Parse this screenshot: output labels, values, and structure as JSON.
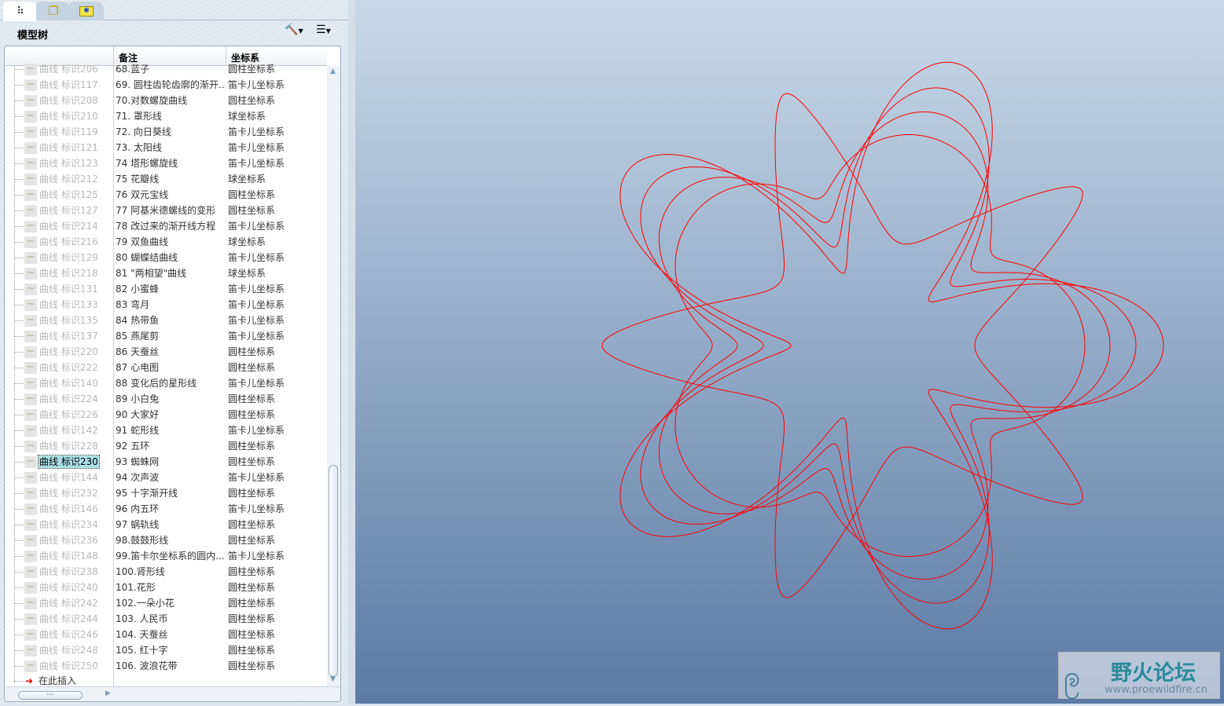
{
  "tabs": [
    {
      "icon": "model-tree-icon"
    },
    {
      "icon": "layers-icon"
    },
    {
      "icon": "folder-icon"
    }
  ],
  "panel_title": "模型树",
  "columns": [
    "备注",
    "坐标系"
  ],
  "rows": [
    {
      "name": "曲线 标识206",
      "note": "68.蓝子",
      "cs": "圆柱坐标系"
    },
    {
      "name": "曲线 标识117",
      "note": "69. 圆柱齿轮齿廓的渐开...",
      "cs": "笛卡儿坐标系"
    },
    {
      "name": "曲线 标识208",
      "note": "70.对数螺旋曲线",
      "cs": "圆柱坐标系"
    },
    {
      "name": "曲线 标识210",
      "note": "71. 罩形线",
      "cs": "球坐标系"
    },
    {
      "name": "曲线 标识119",
      "note": "72. 向日葵线",
      "cs": "笛卡儿坐标系"
    },
    {
      "name": "曲线 标识121",
      "note": "73. 太阳线",
      "cs": "笛卡儿坐标系"
    },
    {
      "name": "曲线 标识123",
      "note": "74 塔形螺旋线",
      "cs": "笛卡儿坐标系"
    },
    {
      "name": "曲线 标识212",
      "note": "75 花瓣线",
      "cs": "球坐标系"
    },
    {
      "name": "曲线 标识125",
      "note": "76 双元宝线",
      "cs": "圆柱坐标系"
    },
    {
      "name": "曲线 标识127",
      "note": "77 阿基米德螺线的变形",
      "cs": "圆柱坐标系"
    },
    {
      "name": "曲线 标识214",
      "note": "78 改过来的渐开线方程",
      "cs": "笛卡儿坐标系"
    },
    {
      "name": "曲线 标识216",
      "note": "79 双鱼曲线",
      "cs": "球坐标系"
    },
    {
      "name": "曲线 标识129",
      "note": "80 蝴蝶结曲线",
      "cs": "笛卡儿坐标系"
    },
    {
      "name": "曲线 标识218",
      "note": "81 \"两相望\"曲线",
      "cs": "球坐标系"
    },
    {
      "name": "曲线 标识131",
      "note": "82 小蜜蜂",
      "cs": "笛卡儿坐标系"
    },
    {
      "name": "曲线 标识133",
      "note": "83 弯月",
      "cs": "笛卡儿坐标系"
    },
    {
      "name": "曲线 标识135",
      "note": "84 热带鱼",
      "cs": "笛卡儿坐标系"
    },
    {
      "name": "曲线 标识137",
      "note": "85 燕尾剪",
      "cs": "笛卡儿坐标系"
    },
    {
      "name": "曲线 标识220",
      "note": "86 天蚕丝",
      "cs": "圆柱坐标系"
    },
    {
      "name": "曲线 标识222",
      "note": "87 心电图",
      "cs": "圆柱坐标系"
    },
    {
      "name": "曲线 标识140",
      "note": "88 变化后的星形线",
      "cs": "笛卡儿坐标系"
    },
    {
      "name": "曲线 标识224",
      "note": "89 小白兔",
      "cs": "圆柱坐标系"
    },
    {
      "name": "曲线 标识226",
      "note": "90 大家好",
      "cs": "圆柱坐标系"
    },
    {
      "name": "曲线 标识142",
      "note": "91 蛇形线",
      "cs": "笛卡儿坐标系"
    },
    {
      "name": "曲线 标识228",
      "note": "92 五环",
      "cs": "圆柱坐标系"
    },
    {
      "name": "曲线 标识230",
      "note": "93 蜘蛛网",
      "cs": "圆柱坐标系",
      "selected": true
    },
    {
      "name": "曲线 标识144",
      "note": "94 次声波",
      "cs": "笛卡儿坐标系"
    },
    {
      "name": "曲线 标识232",
      "note": "95 十字渐开线",
      "cs": "圆柱坐标系"
    },
    {
      "name": "曲线 标识146",
      "note": "96 内五环",
      "cs": "笛卡儿坐标系"
    },
    {
      "name": "曲线 标识234",
      "note": "97 蜗轨线",
      "cs": "圆柱坐标系"
    },
    {
      "name": "曲线 标识236",
      "note": "98.鼓鼓形线",
      "cs": "圆柱坐标系"
    },
    {
      "name": "曲线 标识148",
      "note": "99.笛卡尔坐标系的圆内...",
      "cs": "笛卡儿坐标系"
    },
    {
      "name": "曲线 标识238",
      "note": "100.肾形线",
      "cs": "圆柱坐标系"
    },
    {
      "name": "曲线 标识240",
      "note": "101.花形",
      "cs": "圆柱坐标系"
    },
    {
      "name": "曲线 标识242",
      "note": "102.一朵小花",
      "cs": "圆柱坐标系"
    },
    {
      "name": "曲线 标识244",
      "note": "103. 人民币",
      "cs": "圆柱坐标系"
    },
    {
      "name": "曲线 标识246",
      "note": "104. 天蚕丝",
      "cs": "圆柱坐标系"
    },
    {
      "name": "曲线 标识248",
      "note": "105. 红十字",
      "cs": "圆柱坐标系"
    },
    {
      "name": "曲线 标识250",
      "note": "106. 波浪花带",
      "cs": "圆柱坐标系"
    }
  ],
  "insert_here": "在此插入",
  "curve_color": "#ff0000",
  "watermark": {
    "title": "野火论坛",
    "url": "www.proewildfire.cn"
  }
}
